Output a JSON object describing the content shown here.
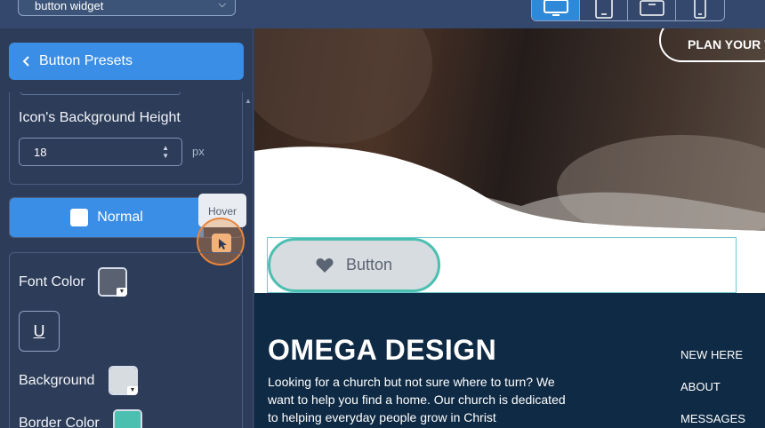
{
  "topbar": {
    "widget_select": "button widget",
    "devices": [
      {
        "name": "desktop",
        "active": true
      },
      {
        "name": "tablet-portrait",
        "active": false
      },
      {
        "name": "tablet-landscape",
        "active": false
      },
      {
        "name": "mobile",
        "active": false
      }
    ]
  },
  "panel": {
    "presets_label": "Button Presets",
    "icon_bg_height_label": "Icon's Background Height",
    "icon_bg_height_value": "18",
    "unit": "px",
    "state_normal": "Normal",
    "tooltip_hover": "Hover",
    "font_color_label": "Font Color",
    "font_color": "#5a6272",
    "underline_label": "U",
    "background_label": "Background",
    "background_color": "#d7dce1",
    "border_color_label": "Border Color",
    "border_color": "#4bbfb0"
  },
  "preview": {
    "plan_button": "PLAN YOUR V",
    "demo_button_label": "Button",
    "brand": "OMEGA DESIGN",
    "blurb": "Looking for a church but not sure where to turn? We want to help you find a home. Our church is dedicated to helping everyday people grow in Christ",
    "nav": [
      "NEW HERE",
      "ABOUT",
      "MESSAGES"
    ]
  }
}
